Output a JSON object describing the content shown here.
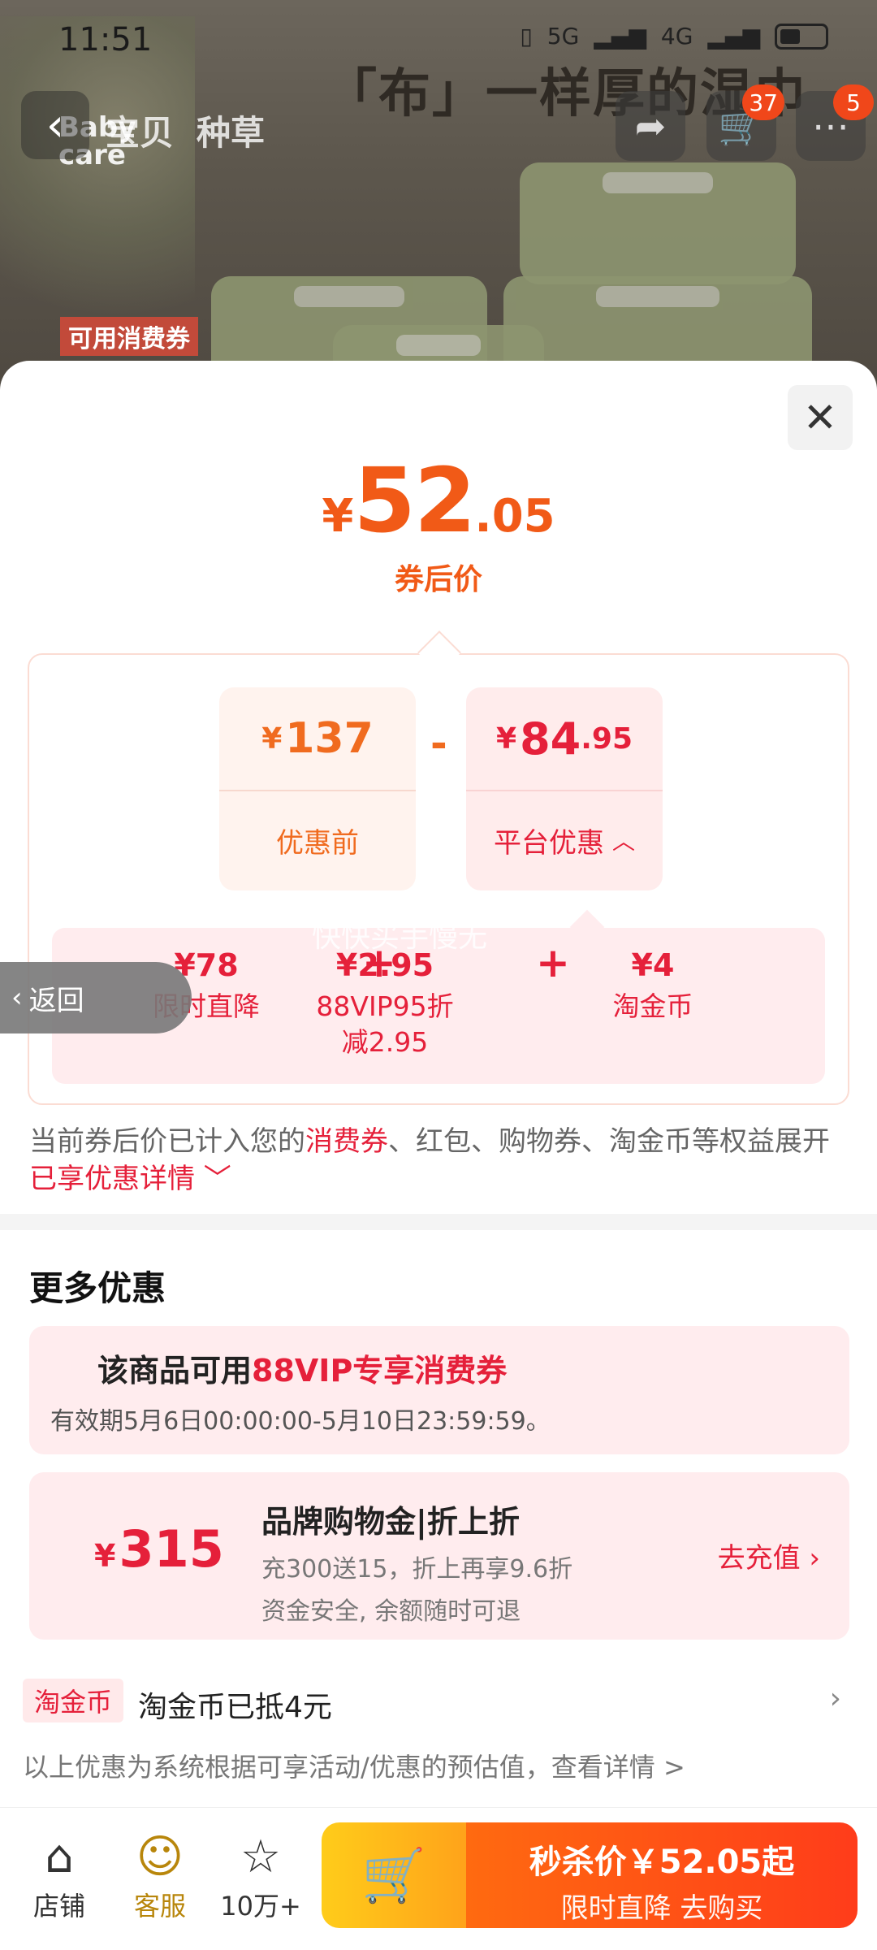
{
  "status_bar": {
    "time": "11:51",
    "network_5g": "5G",
    "network_4g": "4G"
  },
  "background": {
    "banner_title": "「布」一样厚的湿巾",
    "brand_line1": "Baby",
    "brand_line2": "care",
    "tabs": [
      "宝贝",
      "种草"
    ],
    "promo_tag": "可用消费券",
    "cart_badge": "37",
    "more_badge": "5"
  },
  "sheet": {
    "price": {
      "currency": "¥",
      "integer": "52",
      "decimal": ".05",
      "label": "券后价"
    },
    "before": {
      "currency": "¥",
      "amount": "137",
      "label": "优惠前"
    },
    "minus": "-",
    "platform": {
      "currency": "¥",
      "integer": "84",
      "decimal": ".95",
      "label": "平台优惠"
    },
    "watermark": "快快买手慢无",
    "sub_discounts": [
      {
        "value": "¥78",
        "label": "限时直降"
      },
      {
        "value": "¥2.95",
        "label": "88VIP95折",
        "label2": "减2.95"
      },
      {
        "value": "¥4",
        "label": "淘金币"
      }
    ],
    "plus": "+",
    "note": {
      "part1": "当前券后价已计入您的",
      "hl1": "消费券",
      "part2": "、红包、购物券、淘金币等权益展开",
      "hl2": "已享优惠详情"
    },
    "more": {
      "title": "更多优惠",
      "coupon_prefix": "该商品可用",
      "coupon_highlight": "88VIP专享消费券",
      "coupon_validity": "有效期5月6日00:00:00-5月10日23:59:59。",
      "float_back": "返回",
      "brand_card": {
        "currency": "¥",
        "amount": "315",
        "title": "品牌购物金|折上折",
        "line1": "充300送15，折上再享9.6折",
        "line2": "资金安全, 余额随时可退",
        "cta": "去充值"
      },
      "coin_tag": "淘金币",
      "coin_text": "淘金币已抵4元",
      "disclaimer": "以上优惠为系统根据可享活动/优惠的预估值，查看详情 >"
    }
  },
  "bottom_bar": {
    "store": "店铺",
    "service": "客服",
    "favorites": "10万+",
    "buy_line1": "秒杀价￥52.05起",
    "buy_line2": "限时直降  去购买"
  },
  "colors": {
    "accent_orange": "#f15a17",
    "accent_red": "#e5203a",
    "buy_gradient_start": "#ff6a10",
    "cart_gradient_start": "#ffcc1a"
  }
}
